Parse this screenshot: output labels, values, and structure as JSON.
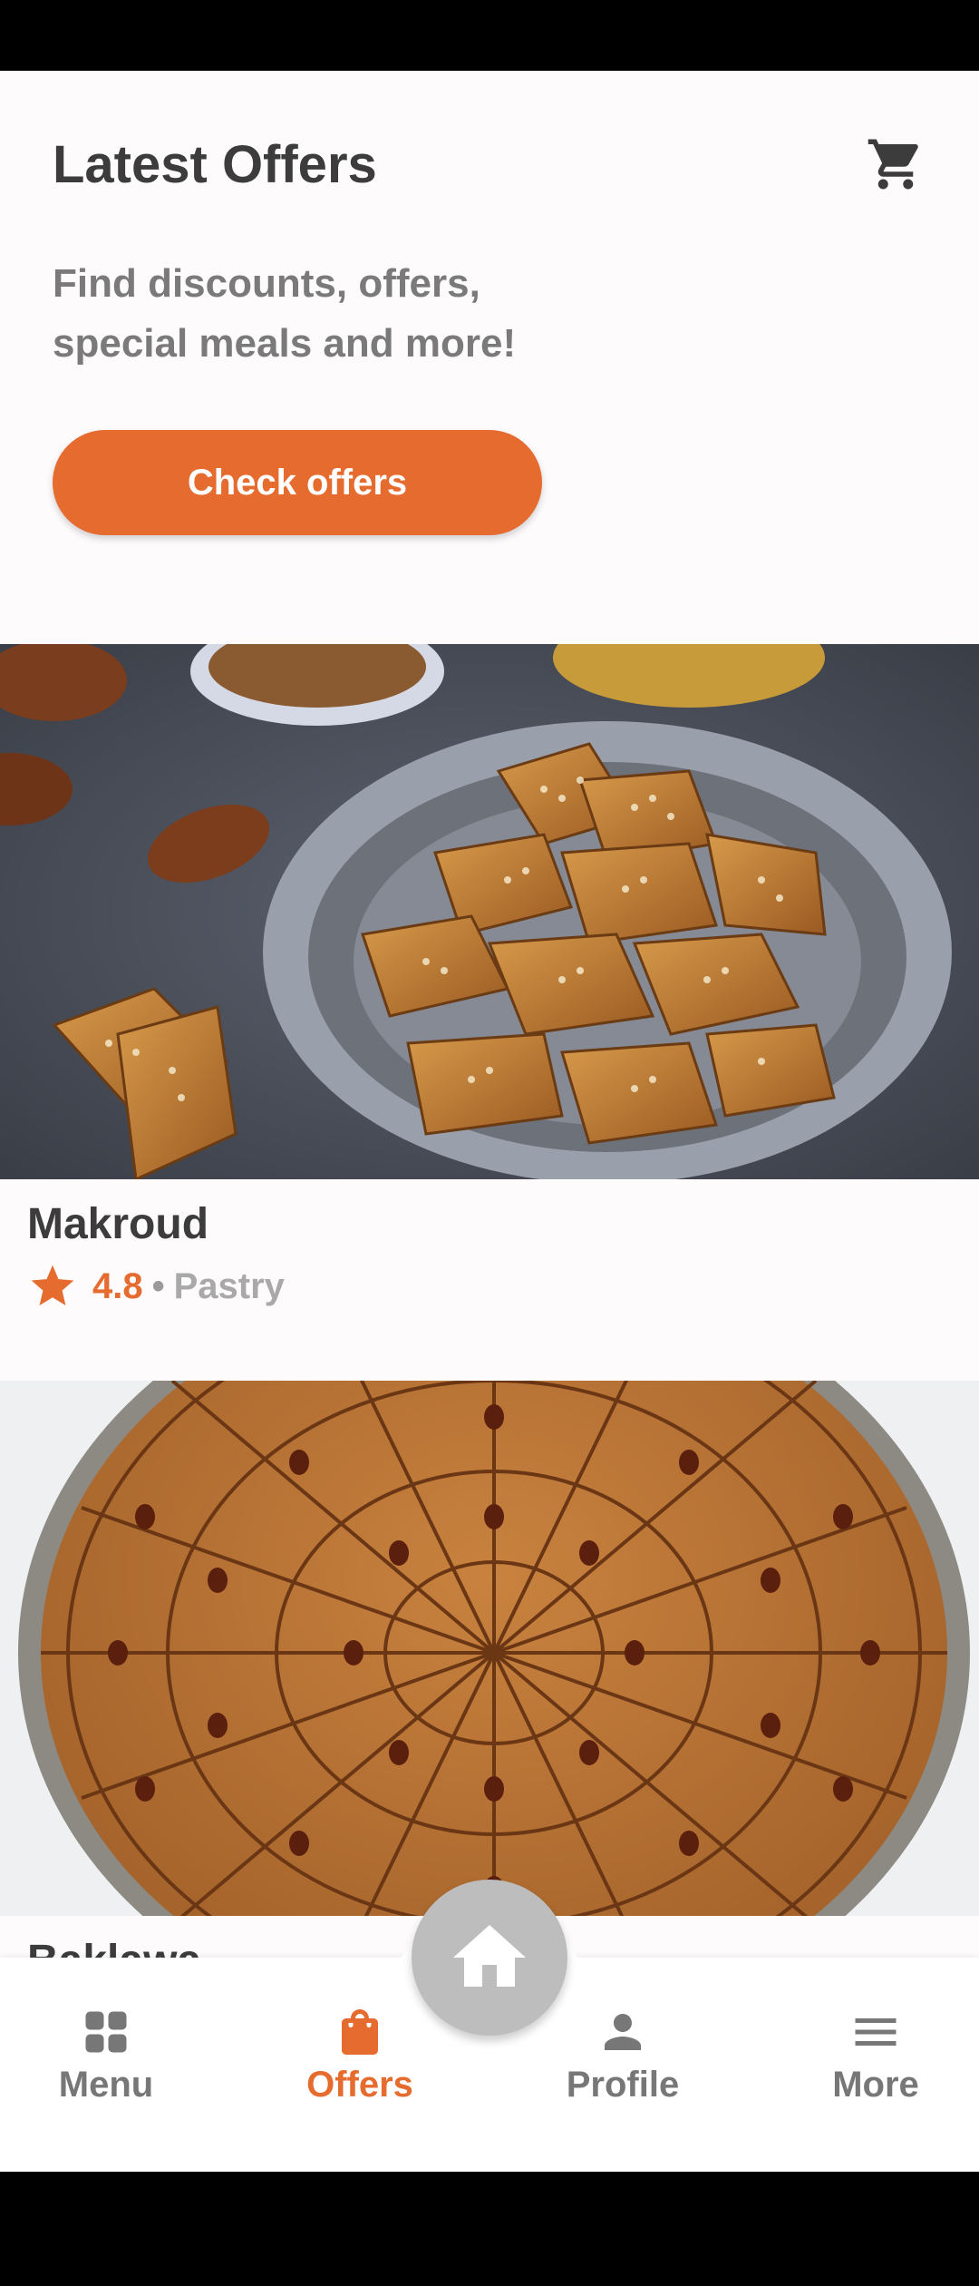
{
  "header": {
    "title": "Latest Offers",
    "subtitle": "Find discounts, offers, special meals and more!",
    "cta_label": "Check offers",
    "cart_icon": "cart-icon"
  },
  "offers": [
    {
      "name": "Makroud",
      "rating": "4.8",
      "separator": "•",
      "category": "Pastry"
    },
    {
      "name": "Baklawa"
    }
  ],
  "bottom_nav": {
    "items": [
      {
        "label": "Menu",
        "icon": "grid-icon",
        "active": false
      },
      {
        "label": "Offers",
        "icon": "shopping-bag-icon",
        "active": true
      },
      {
        "label": "Profile",
        "icon": "person-icon",
        "active": false
      },
      {
        "label": "More",
        "icon": "hamburger-icon",
        "active": false
      }
    ],
    "home_icon": "home-icon"
  },
  "colors": {
    "accent": "#e56b2f",
    "text_dark": "#3c3c3c",
    "text_muted": "#7a7a7a",
    "nav_inactive": "#777777",
    "home_button": "#bdbdbd"
  }
}
